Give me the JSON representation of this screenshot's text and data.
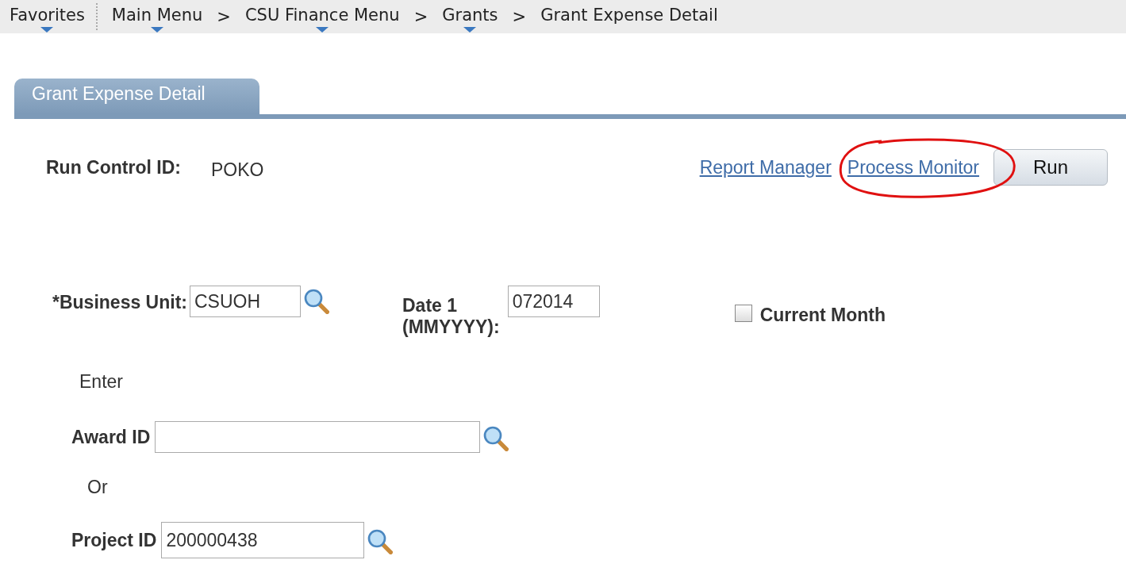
{
  "breadcrumb": {
    "separator": ">",
    "items": [
      {
        "label": "Favorites",
        "has_menu": true
      },
      {
        "label": "Main Menu",
        "has_menu": true
      },
      {
        "label": "CSU Finance Menu",
        "has_menu": true
      },
      {
        "label": "Grants",
        "has_menu": true
      },
      {
        "label": "Grant Expense Detail",
        "has_menu": false
      }
    ]
  },
  "tabs": [
    {
      "label": "Grant Expense Detail",
      "selected": true
    }
  ],
  "run_control": {
    "label": "Run Control ID:",
    "value": "POKO"
  },
  "links": [
    {
      "label": "Report Manager",
      "circled": false
    },
    {
      "label": "Process Monitor",
      "circled": true
    }
  ],
  "run_button": "Run",
  "business_unit": {
    "label": "*Business Unit:",
    "value": "CSUOH"
  },
  "date": {
    "label": "Date 1",
    "sublabel": "(MMYYYY):",
    "value": "072014"
  },
  "current_month": {
    "label": "Current Month",
    "checked": false
  },
  "enter_text": "Enter",
  "award_id": {
    "label": "Award ID"
  },
  "or_text": "Or",
  "project_id": {
    "label": "Project ID",
    "value": "200000438"
  }
}
